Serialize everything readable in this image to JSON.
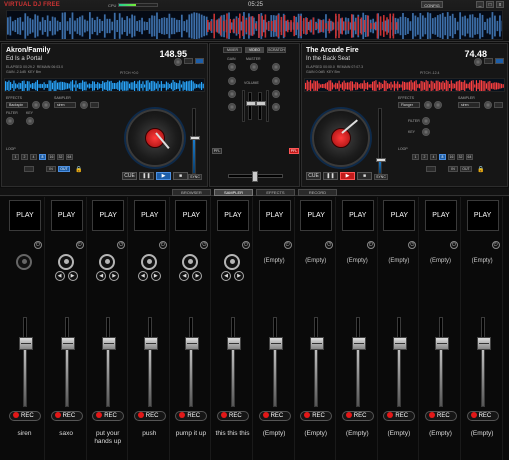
{
  "topbar": {
    "logo": "VIRTUAL DJ FREE",
    "cpu_label": "CPU",
    "cpu_load": 0.45,
    "clock": "05:25",
    "config_label": "CONFIG",
    "minimize": "_",
    "maximize": "□",
    "close": "x"
  },
  "deck_left": {
    "artist": "Akron/Family",
    "title": "Ed Is a Portal",
    "bpm": "148.95",
    "elapsed": "ELAPSED 00:29.2",
    "remain": "REMAIN 06:03.0",
    "gain": "GAIN -2.1dB",
    "key": "KEY Bm",
    "pitch": "PITCH +0.0",
    "effects_label": "EFFECTS",
    "effects_value": "Backspin",
    "sampler_label": "SAMPLER",
    "sampler_value": "siren",
    "filter_label": "FILTER",
    "key_label": "KEY",
    "loop_label": "LOOP",
    "loop_values": [
      "1",
      "2",
      "4",
      "8",
      "16",
      "32",
      "64"
    ],
    "in_label": "IN",
    "out_label": "OUT",
    "cue_label": "CUE",
    "play_symbol": "▶",
    "sync_label": "SYNC",
    "pitch_level": 0.55
  },
  "deck_right": {
    "artist": "The Arcade Fire",
    "title": "In the Back Seat",
    "bpm": "74.48",
    "elapsed": "ELAPSED 00:00.0",
    "remain": "REMAIN 07:07.3",
    "gain": "GAIN 0.0dB",
    "key": "KEY Bm",
    "pitch": "PITCH -12.4",
    "effects_label": "EFFECTS",
    "effects_value": "Flanger",
    "sampler_label": "SAMPLER",
    "sampler_value": "siren",
    "filter_label": "FILTER",
    "key_label": "KEY",
    "loop_label": "LOOP",
    "loop_values": [
      "1",
      "2",
      "4",
      "8",
      "16",
      "32",
      "64"
    ],
    "in_label": "IN",
    "out_label": "OUT",
    "cue_label": "CUE",
    "play_symbol": "▶",
    "sync_label": "SYNC",
    "pitch_level": 0.2
  },
  "mixer": {
    "tabs": [
      "MIXER",
      "VIDEO",
      "SCRATCH"
    ],
    "gain_label": "GAIN",
    "master_label": "MASTER",
    "volume_label": "VOLUME",
    "high_label": "HIGH",
    "mid_label": "MED",
    "low_label": "LOW",
    "cue_left": "CUE",
    "cue_right": "CUE",
    "pfl_left": "PFL",
    "pfl_right": "PFL"
  },
  "lower_tabs": [
    "BROWSER",
    "SAMPLER",
    "EFFECTS",
    "RECORD"
  ],
  "sampler": {
    "play_label": "PLAY",
    "rec_label": "REC",
    "empty_label": "(Empty)",
    "slots": [
      {
        "name": "siren",
        "loaded": true,
        "arrows": false,
        "volume": 0.72
      },
      {
        "name": "saxo",
        "loaded": true,
        "arrows": true,
        "volume": 0.72
      },
      {
        "name": "put your hands up",
        "loaded": true,
        "arrows": true,
        "volume": 0.72
      },
      {
        "name": "push",
        "loaded": true,
        "arrows": true,
        "volume": 0.72
      },
      {
        "name": "pump it up",
        "loaded": true,
        "arrows": true,
        "volume": 0.72
      },
      {
        "name": "this this this",
        "loaded": true,
        "arrows": true,
        "volume": 0.72
      },
      {
        "name": "(Empty)",
        "loaded": false,
        "arrows": false,
        "volume": 0.72
      },
      {
        "name": "(Empty)",
        "loaded": false,
        "arrows": false,
        "volume": 0.72
      },
      {
        "name": "(Empty)",
        "loaded": false,
        "arrows": false,
        "volume": 0.72
      },
      {
        "name": "(Empty)",
        "loaded": false,
        "arrows": false,
        "volume": 0.72
      },
      {
        "name": "(Empty)",
        "loaded": false,
        "arrows": false,
        "volume": 0.72
      },
      {
        "name": "(Empty)",
        "loaded": false,
        "arrows": false,
        "volume": 0.72
      }
    ]
  },
  "colors": {
    "accent_blue": "#1d5ea8",
    "rec_red": "#e31818",
    "waveform_left": "#2aa8ff",
    "waveform_right": "#ff4040"
  }
}
